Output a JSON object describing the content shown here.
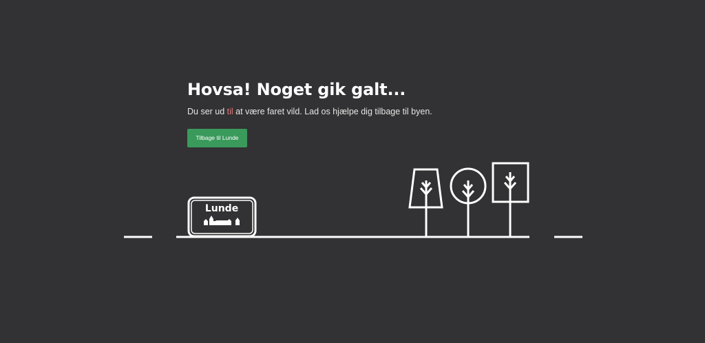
{
  "error": {
    "title": "Hovsa! Noget gik galt...",
    "message_before": "Du ser ud ",
    "message_highlight": "til",
    "message_after": " at være faret vild. Lad os hjælpe dig tilbage til byen.",
    "button_label": "Tilbage til Lunde"
  },
  "illustration": {
    "town_sign_text": "Lunde"
  },
  "colors": {
    "background": "#323133",
    "foreground": "#ffffff",
    "button": "#3a9a5b",
    "highlight": "#e57a7a"
  }
}
